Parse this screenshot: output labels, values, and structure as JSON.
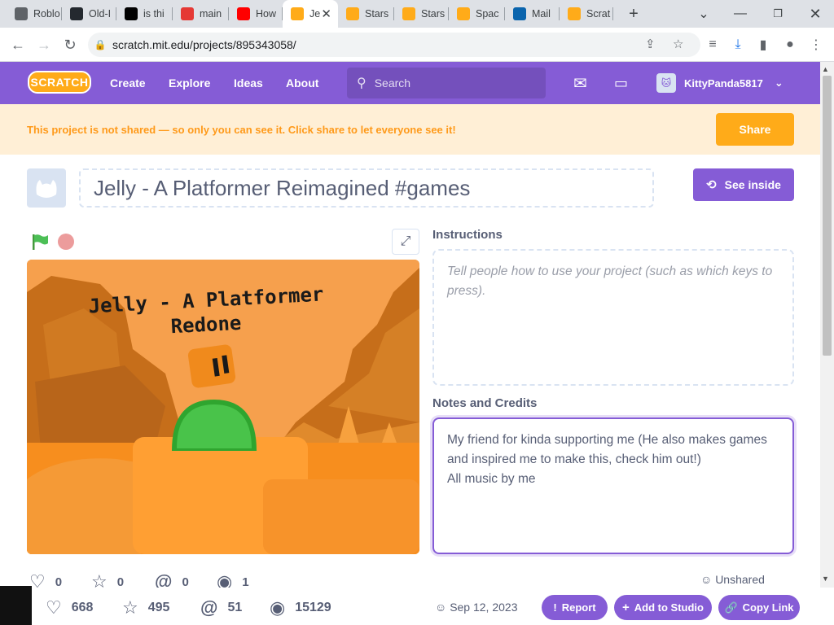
{
  "browser": {
    "tabs": [
      {
        "title": "Roblo",
        "icon": "roblox-icon",
        "color": "#5f6368"
      },
      {
        "title": "Old-I",
        "icon": "github-icon",
        "color": "#24292f"
      },
      {
        "title": "is thi",
        "icon": "tiktok-icon",
        "color": "#010101"
      },
      {
        "title": "main",
        "icon": "bookmark-icon",
        "color": "#e53935"
      },
      {
        "title": "How",
        "icon": "youtube-icon",
        "color": "#ff0000"
      },
      {
        "title": "Je",
        "icon": "scratch-icon",
        "color": "#ffab19",
        "active": true
      },
      {
        "title": "Stars",
        "icon": "scratch-icon",
        "color": "#ffab19"
      },
      {
        "title": "Stars",
        "icon": "scratch-icon",
        "color": "#ffab19"
      },
      {
        "title": "Spac",
        "icon": "scratch-icon",
        "color": "#ffab19"
      },
      {
        "title": "Mail",
        "icon": "outlook-icon",
        "color": "#0a64ad"
      },
      {
        "title": "Scrat",
        "icon": "scratch-icon",
        "color": "#ffab19"
      }
    ],
    "url": "scratch.mit.edu/projects/895343058/"
  },
  "nav": {
    "logo": "SCRATCH",
    "create": "Create",
    "explore": "Explore",
    "ideas": "Ideas",
    "about": "About",
    "search_placeholder": "Search",
    "username": "KittyPanda5817"
  },
  "banner": {
    "message": "This project is not shared — so only you can see it. Click share to let everyone see it!",
    "share": "Share"
  },
  "project": {
    "title": "Jelly - A Platformer Reimagined #games",
    "see_inside": "See inside",
    "stage_title_line1": "Jelly - A Platformer",
    "stage_title_line2": "Redone",
    "instructions_label": "Instructions",
    "instructions_placeholder": "Tell people how to use your project (such as which keys to press).",
    "notes_label": "Notes and Credits",
    "notes_line1": "My friend for kinda supporting me (He also makes games and inspired me to make this, check him out!)",
    "notes_line2": "All music by me",
    "loves": "0",
    "favorites": "0",
    "remixes": "0",
    "views": "1",
    "unshared": "Unshared"
  },
  "bottom": {
    "loves": "668",
    "favorites": "495",
    "remixes": "51",
    "views": "15129",
    "date": "Sep 12, 2023",
    "report": "Report",
    "add_to_studio": "Add to Studio",
    "copy_link": "Copy Link"
  },
  "colors": {
    "scratch_purple": "#855cd6",
    "scratch_orange": "#ffab19",
    "banner_bg": "#ffefd6",
    "text": "#575e75"
  }
}
